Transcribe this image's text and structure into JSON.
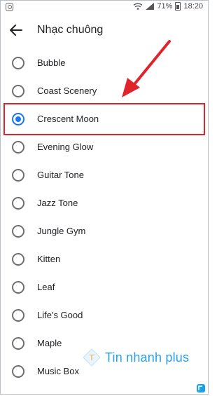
{
  "status_bar": {
    "battery": "71%",
    "time": "18:20"
  },
  "app_bar": {
    "title": "Nhạc chuông",
    "back_icon": "arrow-left-icon"
  },
  "ringtones": [
    {
      "label": "Bubble",
      "selected": false
    },
    {
      "label": "Coast Scenery",
      "selected": false
    },
    {
      "label": "Crescent Moon",
      "selected": true
    },
    {
      "label": "Evening Glow",
      "selected": false
    },
    {
      "label": "Guitar Tone",
      "selected": false
    },
    {
      "label": "Jazz Tone",
      "selected": false
    },
    {
      "label": "Jungle Gym",
      "selected": false
    },
    {
      "label": "Kitten",
      "selected": false
    },
    {
      "label": "Leaf",
      "selected": false
    },
    {
      "label": "Life's Good",
      "selected": false
    },
    {
      "label": "Maple",
      "selected": false
    },
    {
      "label": "Music Box",
      "selected": false
    }
  ],
  "watermark": {
    "text": "Tin nhanh plus"
  },
  "colors": {
    "accent": "#1877f2",
    "highlight": "#e0242b",
    "watermark": "#28a0e8"
  }
}
